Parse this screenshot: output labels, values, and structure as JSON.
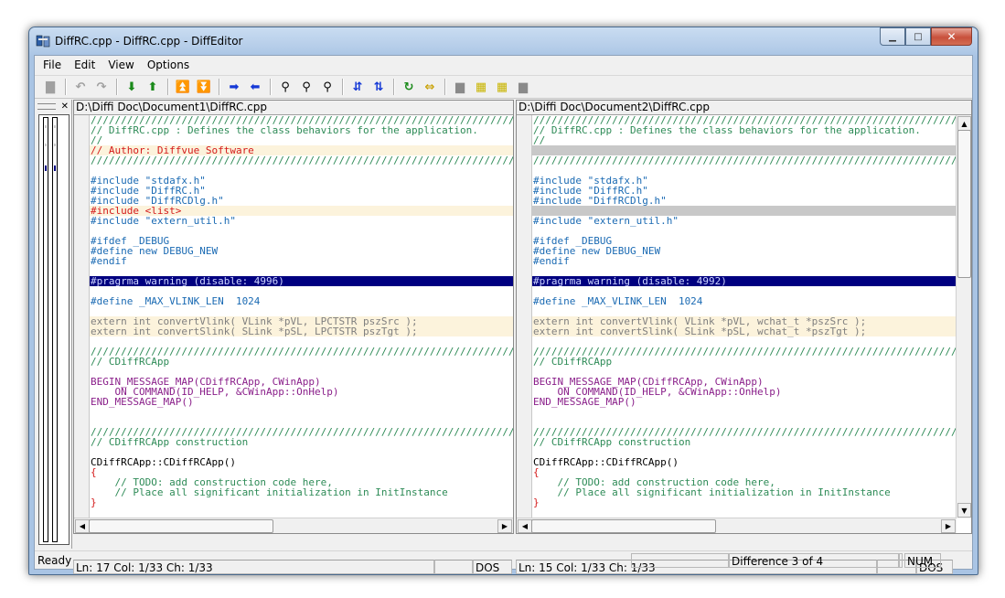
{
  "window": {
    "title": "DiffRC.cpp - DiffRC.cpp - DiffEditor",
    "minimize_glyph": "▁",
    "maximize_glyph": "□",
    "close_glyph": "✕"
  },
  "menu": [
    "File",
    "Edit",
    "View",
    "Options"
  ],
  "toolbar": {
    "icons": [
      {
        "name": "save-icon",
        "glyph": "▇",
        "color": "#a0a0a0"
      },
      {
        "sep": true
      },
      {
        "name": "undo-icon",
        "glyph": "↶",
        "color": "#a0a0a0"
      },
      {
        "name": "redo-icon",
        "glyph": "↷",
        "color": "#a0a0a0"
      },
      {
        "sep": true
      },
      {
        "name": "next-diff-icon",
        "glyph": "⬇",
        "color": "#1a8a1a"
      },
      {
        "name": "prev-diff-icon",
        "glyph": "⬆",
        "color": "#1a8a1a"
      },
      {
        "sep": true
      },
      {
        "name": "first-diff-icon",
        "glyph": "⏫",
        "color": "#1a8a1a"
      },
      {
        "name": "last-diff-icon",
        "glyph": "⏬",
        "color": "#1a8a1a"
      },
      {
        "sep": true
      },
      {
        "name": "copy-right-icon",
        "glyph": "➡",
        "color": "#1438d6"
      },
      {
        "name": "copy-left-icon",
        "glyph": "⬅",
        "color": "#1438d6"
      },
      {
        "sep": true
      },
      {
        "name": "find-icon",
        "glyph": "⚲",
        "color": "#000000"
      },
      {
        "name": "find-next-icon",
        "glyph": "⚲",
        "color": "#000000"
      },
      {
        "name": "find-prev-icon",
        "glyph": "⚲",
        "color": "#000000"
      },
      {
        "sep": true
      },
      {
        "name": "sync-down-icon",
        "glyph": "⇵",
        "color": "#1438d6"
      },
      {
        "name": "sync-up-icon",
        "glyph": "⇅",
        "color": "#1438d6"
      },
      {
        "sep": true
      },
      {
        "name": "refresh-icon",
        "glyph": "↻",
        "color": "#1a8a1a"
      },
      {
        "name": "swap-icon",
        "glyph": "⇔",
        "color": "#c8a000"
      },
      {
        "sep": true
      },
      {
        "name": "layout-1-icon",
        "glyph": "▆",
        "color": "#8a8a8a"
      },
      {
        "name": "layout-2-icon",
        "glyph": "▦",
        "color": "#c8b400"
      },
      {
        "name": "layout-3-icon",
        "glyph": "▦",
        "color": "#c8b400"
      },
      {
        "name": "layout-4-icon",
        "glyph": "▆",
        "color": "#8a8a8a"
      }
    ]
  },
  "colors": {
    "selection": "#000080",
    "changed_bg": "#fcf3dc",
    "gap_bg": "#c8c8c8",
    "comment": "#2e8b57",
    "preprocessor": "#1a6ab3",
    "changed_text": "#d41a1a",
    "macro": "#8a1f8a"
  },
  "left_pane": {
    "path": "D:\\Diffi Doc\\Document1\\DiffRC.cpp",
    "status": {
      "pos": "Ln: 17  Col: 1/33  Ch: 1/33",
      "blank": "",
      "encoding": "DOS"
    },
    "lines": [
      {
        "t": "////////////////////////////////////////////////////////////////////////////",
        "c": "c-comment"
      },
      {
        "t": "// DiffRC.cpp : Defines the class behaviors for the application.",
        "c": "c-comment"
      },
      {
        "t": "//",
        "c": "c-comment"
      },
      {
        "t": "// Author: Diffvue Software",
        "c": "c-red",
        "bg": "changed"
      },
      {
        "t": "////////////////////////////////////////////////////////////////////////////",
        "c": "c-comment"
      },
      {
        "t": "",
        "c": "c-text"
      },
      {
        "t": "#include \"stdafx.h\"",
        "c": "c-pre"
      },
      {
        "t": "#include \"DiffRC.h\"",
        "c": "c-pre"
      },
      {
        "t": "#include \"DiffRCDlg.h\"",
        "c": "c-pre"
      },
      {
        "t": "#include <list>",
        "c": "c-red",
        "bg": "changed"
      },
      {
        "t": "#include \"extern_util.h\"",
        "c": "c-pre"
      },
      {
        "t": "",
        "c": "c-text"
      },
      {
        "t": "#ifdef _DEBUG",
        "c": "c-pre"
      },
      {
        "t": "#define new DEBUG_NEW",
        "c": "c-pre"
      },
      {
        "t": "#endif",
        "c": "c-pre"
      },
      {
        "t": "",
        "c": "c-text"
      },
      {
        "t": "#pragrma warning (disable: 4996)",
        "c": "c-pre",
        "bg": "sel"
      },
      {
        "t": "",
        "c": "c-text"
      },
      {
        "t": "#define _MAX_VLINK_LEN  1024",
        "c": "c-pre"
      },
      {
        "t": "",
        "c": "c-text"
      },
      {
        "t": "extern int convertVlink( VLink *pVL, LPCTSTR pszSrc );",
        "c": "c-dim",
        "bg": "changed"
      },
      {
        "t": "extern int convertSlink( SLink *pSL, LPCTSTR pszTgt );",
        "c": "c-dim",
        "bg": "changed"
      },
      {
        "t": "",
        "c": "c-text"
      },
      {
        "t": "////////////////////////////////////////////////////////////////////////////",
        "c": "c-comment"
      },
      {
        "t": "// CDiffRCApp",
        "c": "c-comment"
      },
      {
        "t": "",
        "c": "c-text"
      },
      {
        "t": "BEGIN_MESSAGE_MAP(CDiffRCApp, CWinApp)",
        "c": "c-macro"
      },
      {
        "t": "    ON_COMMAND(ID_HELP, &CWinApp::OnHelp)",
        "c": "c-macro"
      },
      {
        "t": "END_MESSAGE_MAP()",
        "c": "c-macro"
      },
      {
        "t": "",
        "c": "c-text"
      },
      {
        "t": "",
        "c": "c-text"
      },
      {
        "t": "////////////////////////////////////////////////////////////////////////////",
        "c": "c-comment"
      },
      {
        "t": "// CDiffRCApp construction",
        "c": "c-comment"
      },
      {
        "t": "",
        "c": "c-text"
      },
      {
        "t": "CDiffRCApp::CDiffRCApp()",
        "c": "c-text"
      },
      {
        "t": "{",
        "c": "c-red"
      },
      {
        "t": "    // TODO: add construction code here,",
        "c": "c-comment"
      },
      {
        "t": "    // Place all significant initialization in InitInstance",
        "c": "c-comment"
      },
      {
        "t": "}",
        "c": "c-red"
      }
    ]
  },
  "right_pane": {
    "path": "D:\\Diffi Doc\\Document2\\DiffRC.cpp",
    "status": {
      "pos": "Ln: 15  Col: 1/33  Ch: 1/33",
      "blank": "",
      "encoding": "DOS"
    },
    "lines": [
      {
        "t": "////////////////////////////////////////////////////////////////////////////",
        "c": "c-comment"
      },
      {
        "t": "// DiffRC.cpp : Defines the class behaviors for the application.",
        "c": "c-comment"
      },
      {
        "t": "//",
        "c": "c-comment"
      },
      {
        "t": "",
        "c": "c-text",
        "bg": "gap"
      },
      {
        "t": "////////////////////////////////////////////////////////////////////////////",
        "c": "c-comment"
      },
      {
        "t": "",
        "c": "c-text"
      },
      {
        "t": "#include \"stdafx.h\"",
        "c": "c-pre"
      },
      {
        "t": "#include \"DiffRC.h\"",
        "c": "c-pre"
      },
      {
        "t": "#include \"DiffRCDlg.h\"",
        "c": "c-pre"
      },
      {
        "t": "",
        "c": "c-text",
        "bg": "gap"
      },
      {
        "t": "#include \"extern_util.h\"",
        "c": "c-pre"
      },
      {
        "t": "",
        "c": "c-text"
      },
      {
        "t": "#ifdef _DEBUG",
        "c": "c-pre"
      },
      {
        "t": "#define new DEBUG_NEW",
        "c": "c-pre"
      },
      {
        "t": "#endif",
        "c": "c-pre"
      },
      {
        "t": "",
        "c": "c-text"
      },
      {
        "t": "#pragrma warning (disable: 4992)",
        "c": "c-pre",
        "bg": "sel"
      },
      {
        "t": "",
        "c": "c-text"
      },
      {
        "t": "#define _MAX_VLINK_LEN  1024",
        "c": "c-pre"
      },
      {
        "t": "",
        "c": "c-text"
      },
      {
        "t": "extern int convertVlink( VLink *pVL, wchat_t *pszSrc );",
        "c": "c-dim",
        "bg": "changed"
      },
      {
        "t": "extern int convertSlink( SLink *pSL, wchat_t *pszTgt );",
        "c": "c-dim",
        "bg": "changed"
      },
      {
        "t": "",
        "c": "c-text"
      },
      {
        "t": "////////////////////////////////////////////////////////////////////////////",
        "c": "c-comment"
      },
      {
        "t": "// CDiffRCApp",
        "c": "c-comment"
      },
      {
        "t": "",
        "c": "c-text"
      },
      {
        "t": "BEGIN_MESSAGE_MAP(CDiffRCApp, CWinApp)",
        "c": "c-macro"
      },
      {
        "t": "    ON_COMMAND(ID_HELP, &CWinApp::OnHelp)",
        "c": "c-macro"
      },
      {
        "t": "END_MESSAGE_MAP()",
        "c": "c-macro"
      },
      {
        "t": "",
        "c": "c-text"
      },
      {
        "t": "",
        "c": "c-text"
      },
      {
        "t": "////////////////////////////////////////////////////////////////////////////",
        "c": "c-comment"
      },
      {
        "t": "// CDiffRCApp construction",
        "c": "c-comment"
      },
      {
        "t": "",
        "c": "c-text"
      },
      {
        "t": "CDiffRCApp::CDiffRCApp()",
        "c": "c-text"
      },
      {
        "t": "{",
        "c": "c-red"
      },
      {
        "t": "    // TODO: add construction code here,",
        "c": "c-comment"
      },
      {
        "t": "    // Place all significant initialization in InitInstance",
        "c": "c-comment"
      },
      {
        "t": "}",
        "c": "c-red"
      }
    ]
  },
  "statusbar": {
    "ready": "Ready",
    "blank": "",
    "difference": "Difference 3 of 4",
    "blank2": "",
    "num": "NUM"
  }
}
